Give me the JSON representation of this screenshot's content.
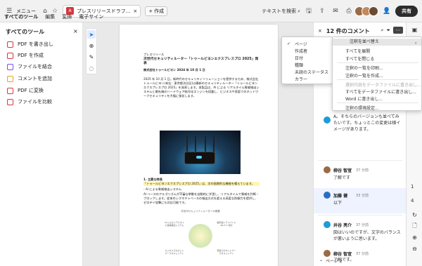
{
  "titlebar": {
    "menu_label": "メニュー",
    "doc_tab_title": "プレスリリースドラフ...",
    "new_tab_label": "作成",
    "search_text": "テキストを検索",
    "share_label": "共有"
  },
  "subtabs": [
    "すべてのツール",
    "編集",
    "変換",
    "電子サイン"
  ],
  "tools_panel": {
    "title": "すべてのツール",
    "items": [
      {
        "label": "PDF を書き出し",
        "color": "#d7373f"
      },
      {
        "label": "PDF を作成",
        "color": "#d7373f"
      },
      {
        "label": "ファイルを結合",
        "color": "#7f4ee0"
      },
      {
        "label": "コメントを追加",
        "color": "#e6a11a"
      },
      {
        "label": "PDF に変換",
        "color": "#d7373f"
      },
      {
        "label": "ファイルを比較",
        "color": "#d7373f"
      }
    ]
  },
  "document": {
    "label": "プレスリリース",
    "title": "次世代セキュリティルーター「トゥールビヨンエクスプレスプロ 2025」発表",
    "company_line": "株式会社トゥールビヨン  2024 年 10 月 1 日",
    "para1": "2025 年 10 月 1 日。新時代のセキュリティソリューションを提供するため、株式会社トゥールビヨン(本社：東京都渋谷区)は最新のセキュリティルーター「トゥールビヨンエクスプレスプロ 2025」を発表します。本製品は、AI による リアルタイム脅威検出システムと最先端のハードウェア暗号化エンジンを搭載し、ビジネスや家庭でのネットワークセキュリティを大幅に強化します。",
    "features_title": "1. 主要な特長",
    "features_line1": "「トゥールビヨンエクスプレスプロ 2025」は、次の画期的な機能を備えています。",
    "features_line2": "- AI による脅威検出システム",
    "features_line3": "AI ベースのアルゴリズムが不審な挙動を自動的に学習し、リアルタイムで脅威を判断・ブロックします。従来のシグネチャベースの検出方式を超える高度な防御力を提供し、ゼロデイ攻撃にも対応可能です。",
    "diagram_title": "次世代セキュリティルーターの概要",
    "diagram_nodes": [
      "AI によるリアルタイム脅威検出システム",
      "超高速トライバンドWi-Fi 7 対応",
      "ビジネスでのネットワークセキュリティ",
      "家庭でのネットワークセキュリティ"
    ]
  },
  "comments_panel": {
    "title": "12 件のコメント",
    "comments": [
      {
        "author": "",
        "time": "",
        "body": "A。そちらのバージョンも並べてみたいです。ちょっとこの変更は様イメージがあります。"
      },
      {
        "author": "柳谷 智宣",
        "time": "37 分前",
        "body": "了解です"
      },
      {
        "author": "加藤 健",
        "time": "33 分前",
        "body": "以下"
      },
      {
        "author": "井谷 亮介",
        "time": "37 分前",
        "body": "図はいいのですが、文字のバランスが悪いように思います。"
      },
      {
        "author": "柳谷 智宣",
        "time": "37 分前",
        "body": "了解です。"
      }
    ],
    "page_label": "ページ 2"
  },
  "rail": {
    "page_current": "1",
    "page_total": "4"
  },
  "sort_menu": {
    "items": [
      "ページ",
      "作成者",
      "日付",
      "種類",
      "未読のステータス",
      "カラー"
    ],
    "checked_index": 0
  },
  "options_menu": {
    "items": [
      {
        "label": "注釈を並べ替え",
        "state": "selected"
      },
      {
        "label": "すべてを展開",
        "state": "normal"
      },
      {
        "label": "すべてを閉じる",
        "state": "normal"
      },
      {
        "label": "注釈の一覧を印刷...",
        "state": "normal"
      },
      {
        "label": "注釈の一覧を作成...",
        "state": "normal"
      },
      {
        "label": "選択内容をデータファイルに書き出し...",
        "state": "disabled"
      },
      {
        "label": "すべてをデータファイルに書き出し...",
        "state": "normal"
      },
      {
        "label": "Word に書き出し...",
        "state": "normal"
      },
      {
        "label": "注釈の環境設定...",
        "state": "normal"
      }
    ]
  }
}
